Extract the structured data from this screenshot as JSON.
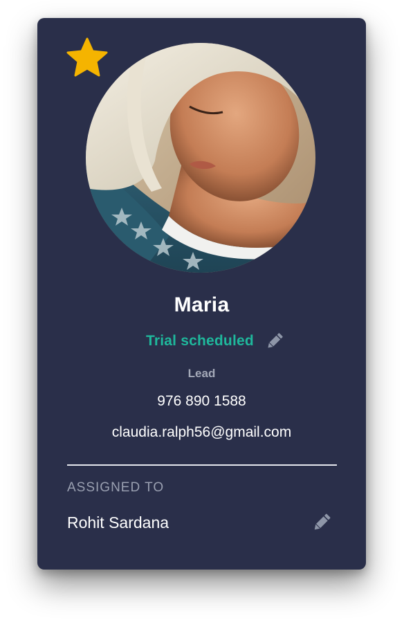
{
  "contact": {
    "name": "Maria",
    "status": "Trial scheduled",
    "type": "Lead",
    "phone": "976 890 1588",
    "email": "claudia.ralph56@gmail.com",
    "favorite": true
  },
  "assignment": {
    "label": "ASSIGNED TO",
    "assignee": "Rohit Sardana"
  },
  "icons": {
    "favorite": "star-icon",
    "edit_status": "pencil-icon",
    "edit_assignee": "pencil-icon"
  },
  "colors": {
    "card_background": "#2a2f4a",
    "status_accent": "#1fb89c",
    "star": "#f5b400",
    "muted_text": "#a4a9b8",
    "icon_gray": "#8e96a8"
  }
}
